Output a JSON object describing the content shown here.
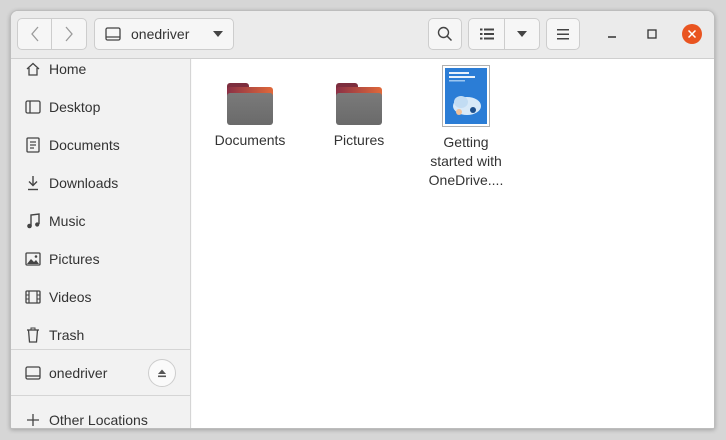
{
  "header": {
    "path_label": "onedriver"
  },
  "sidebar": {
    "items": [
      {
        "label": "Home",
        "icon": "home-icon"
      },
      {
        "label": "Desktop",
        "icon": "desktop-icon"
      },
      {
        "label": "Documents",
        "icon": "documents-icon"
      },
      {
        "label": "Downloads",
        "icon": "downloads-icon"
      },
      {
        "label": "Music",
        "icon": "music-icon"
      },
      {
        "label": "Pictures",
        "icon": "pictures-icon"
      },
      {
        "label": "Videos",
        "icon": "videos-icon"
      },
      {
        "label": "Trash",
        "icon": "trash-icon"
      }
    ],
    "mount": {
      "label": "onedriver",
      "icon": "drive-icon"
    },
    "other": {
      "label": "Other Locations",
      "icon": "plus-icon"
    }
  },
  "content": {
    "items": [
      {
        "name": "Documents",
        "type": "folder"
      },
      {
        "name": "Pictures",
        "type": "folder"
      },
      {
        "name_lines": [
          "Getting",
          "started with",
          "OneDrive...."
        ],
        "type": "pdf"
      }
    ]
  },
  "colors": {
    "accent": "#e95420",
    "folder_tab": "#e0693a",
    "folder_body": "#6f6f6f"
  }
}
